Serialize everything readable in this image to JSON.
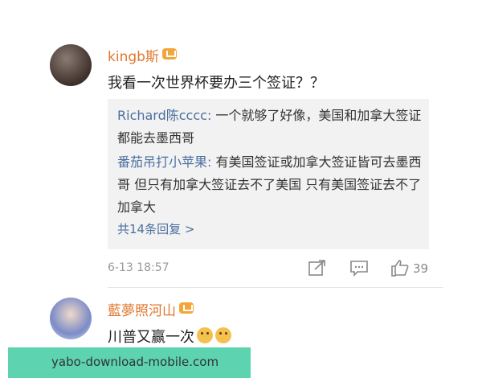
{
  "comment1": {
    "username": "kingb斯",
    "text": "我看一次世界杯要办三个签证？？",
    "replies": [
      {
        "author": "Richard陈cccc:",
        "text": " 一个就够了好像，美国和加拿大签证都能去墨西哥"
      },
      {
        "author": "番茄吊打小苹果:",
        "text": " 有美国签证或加拿大签证皆可去墨西哥 但只有加拿大签证去不了美国 只有美国签证去不了加拿大"
      }
    ],
    "more_replies": "共14条回复 >",
    "timestamp": "6-13 18:57",
    "likes": "39"
  },
  "comment2": {
    "username": "藍夢照河山",
    "text": "川普又赢一次"
  },
  "watermark": "yabo-download-mobile.com",
  "icons": [
    "share-icon",
    "comment-icon",
    "like-icon",
    "vip-badge-icon",
    "doge-emoji-icon"
  ],
  "colors": {
    "username": "#e0772c",
    "reply_author": "#4a6fa0",
    "watermark_bg": "#5dd3b0"
  }
}
